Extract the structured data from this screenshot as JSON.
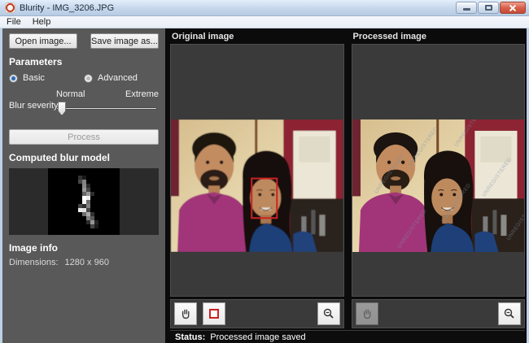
{
  "window": {
    "title": "Blurity - IMG_3206.JPG"
  },
  "menu": {
    "items": [
      "File",
      "Help"
    ]
  },
  "sidebar": {
    "open_button": "Open image...",
    "save_button": "Save image as...",
    "parameters_heading": "Parameters",
    "radio_basic": "Basic",
    "radio_advanced": "Advanced",
    "blur_severity_label": "Blur severity",
    "slider_min_label": "Normal",
    "slider_max_label": "Extreme",
    "process_button": "Process",
    "blur_model_heading": "Computed blur model",
    "image_info_heading": "Image info",
    "dimensions_label": "Dimensions:",
    "dimensions_value": "1280 x 960",
    "blur_kernel": [
      [
        0,
        0,
        50,
        25,
        0,
        0,
        0
      ],
      [
        0,
        0,
        70,
        130,
        0,
        0,
        0
      ],
      [
        0,
        0,
        0,
        135,
        40,
        0,
        0
      ],
      [
        0,
        0,
        0,
        150,
        70,
        0,
        0
      ],
      [
        0,
        0,
        0,
        100,
        150,
        45,
        0
      ],
      [
        0,
        0,
        0,
        255,
        235,
        0,
        0
      ],
      [
        0,
        0,
        0,
        245,
        110,
        0,
        0
      ],
      [
        0,
        0,
        70,
        45,
        130,
        0,
        0
      ],
      [
        0,
        0,
        235,
        225,
        70,
        0,
        0
      ],
      [
        0,
        0,
        0,
        110,
        170,
        50,
        0
      ],
      [
        0,
        0,
        0,
        0,
        130,
        90,
        0
      ],
      [
        0,
        0,
        0,
        0,
        45,
        150,
        35
      ],
      [
        0,
        0,
        0,
        0,
        0,
        70,
        25
      ]
    ]
  },
  "panels": {
    "original_label": "Original image",
    "processed_label": "Processed image",
    "watermark_text": "UNREGISTERED"
  },
  "status": {
    "label": "Status:",
    "message": "Processed image saved"
  },
  "icons": {
    "minimize": "minimize-icon",
    "maximize": "maximize-icon",
    "close": "close-icon",
    "hand": "hand-tool-icon",
    "region_select": "region-select-icon",
    "zoom_out": "zoom-out-icon"
  },
  "colors": {
    "selection_box_red": "#cc2222",
    "accent_radio_blue": "#2f6ab0",
    "sidebar_gray": "#595959",
    "viewport_gray": "#3a3a3a",
    "status_bg": "#0d0d0d"
  }
}
